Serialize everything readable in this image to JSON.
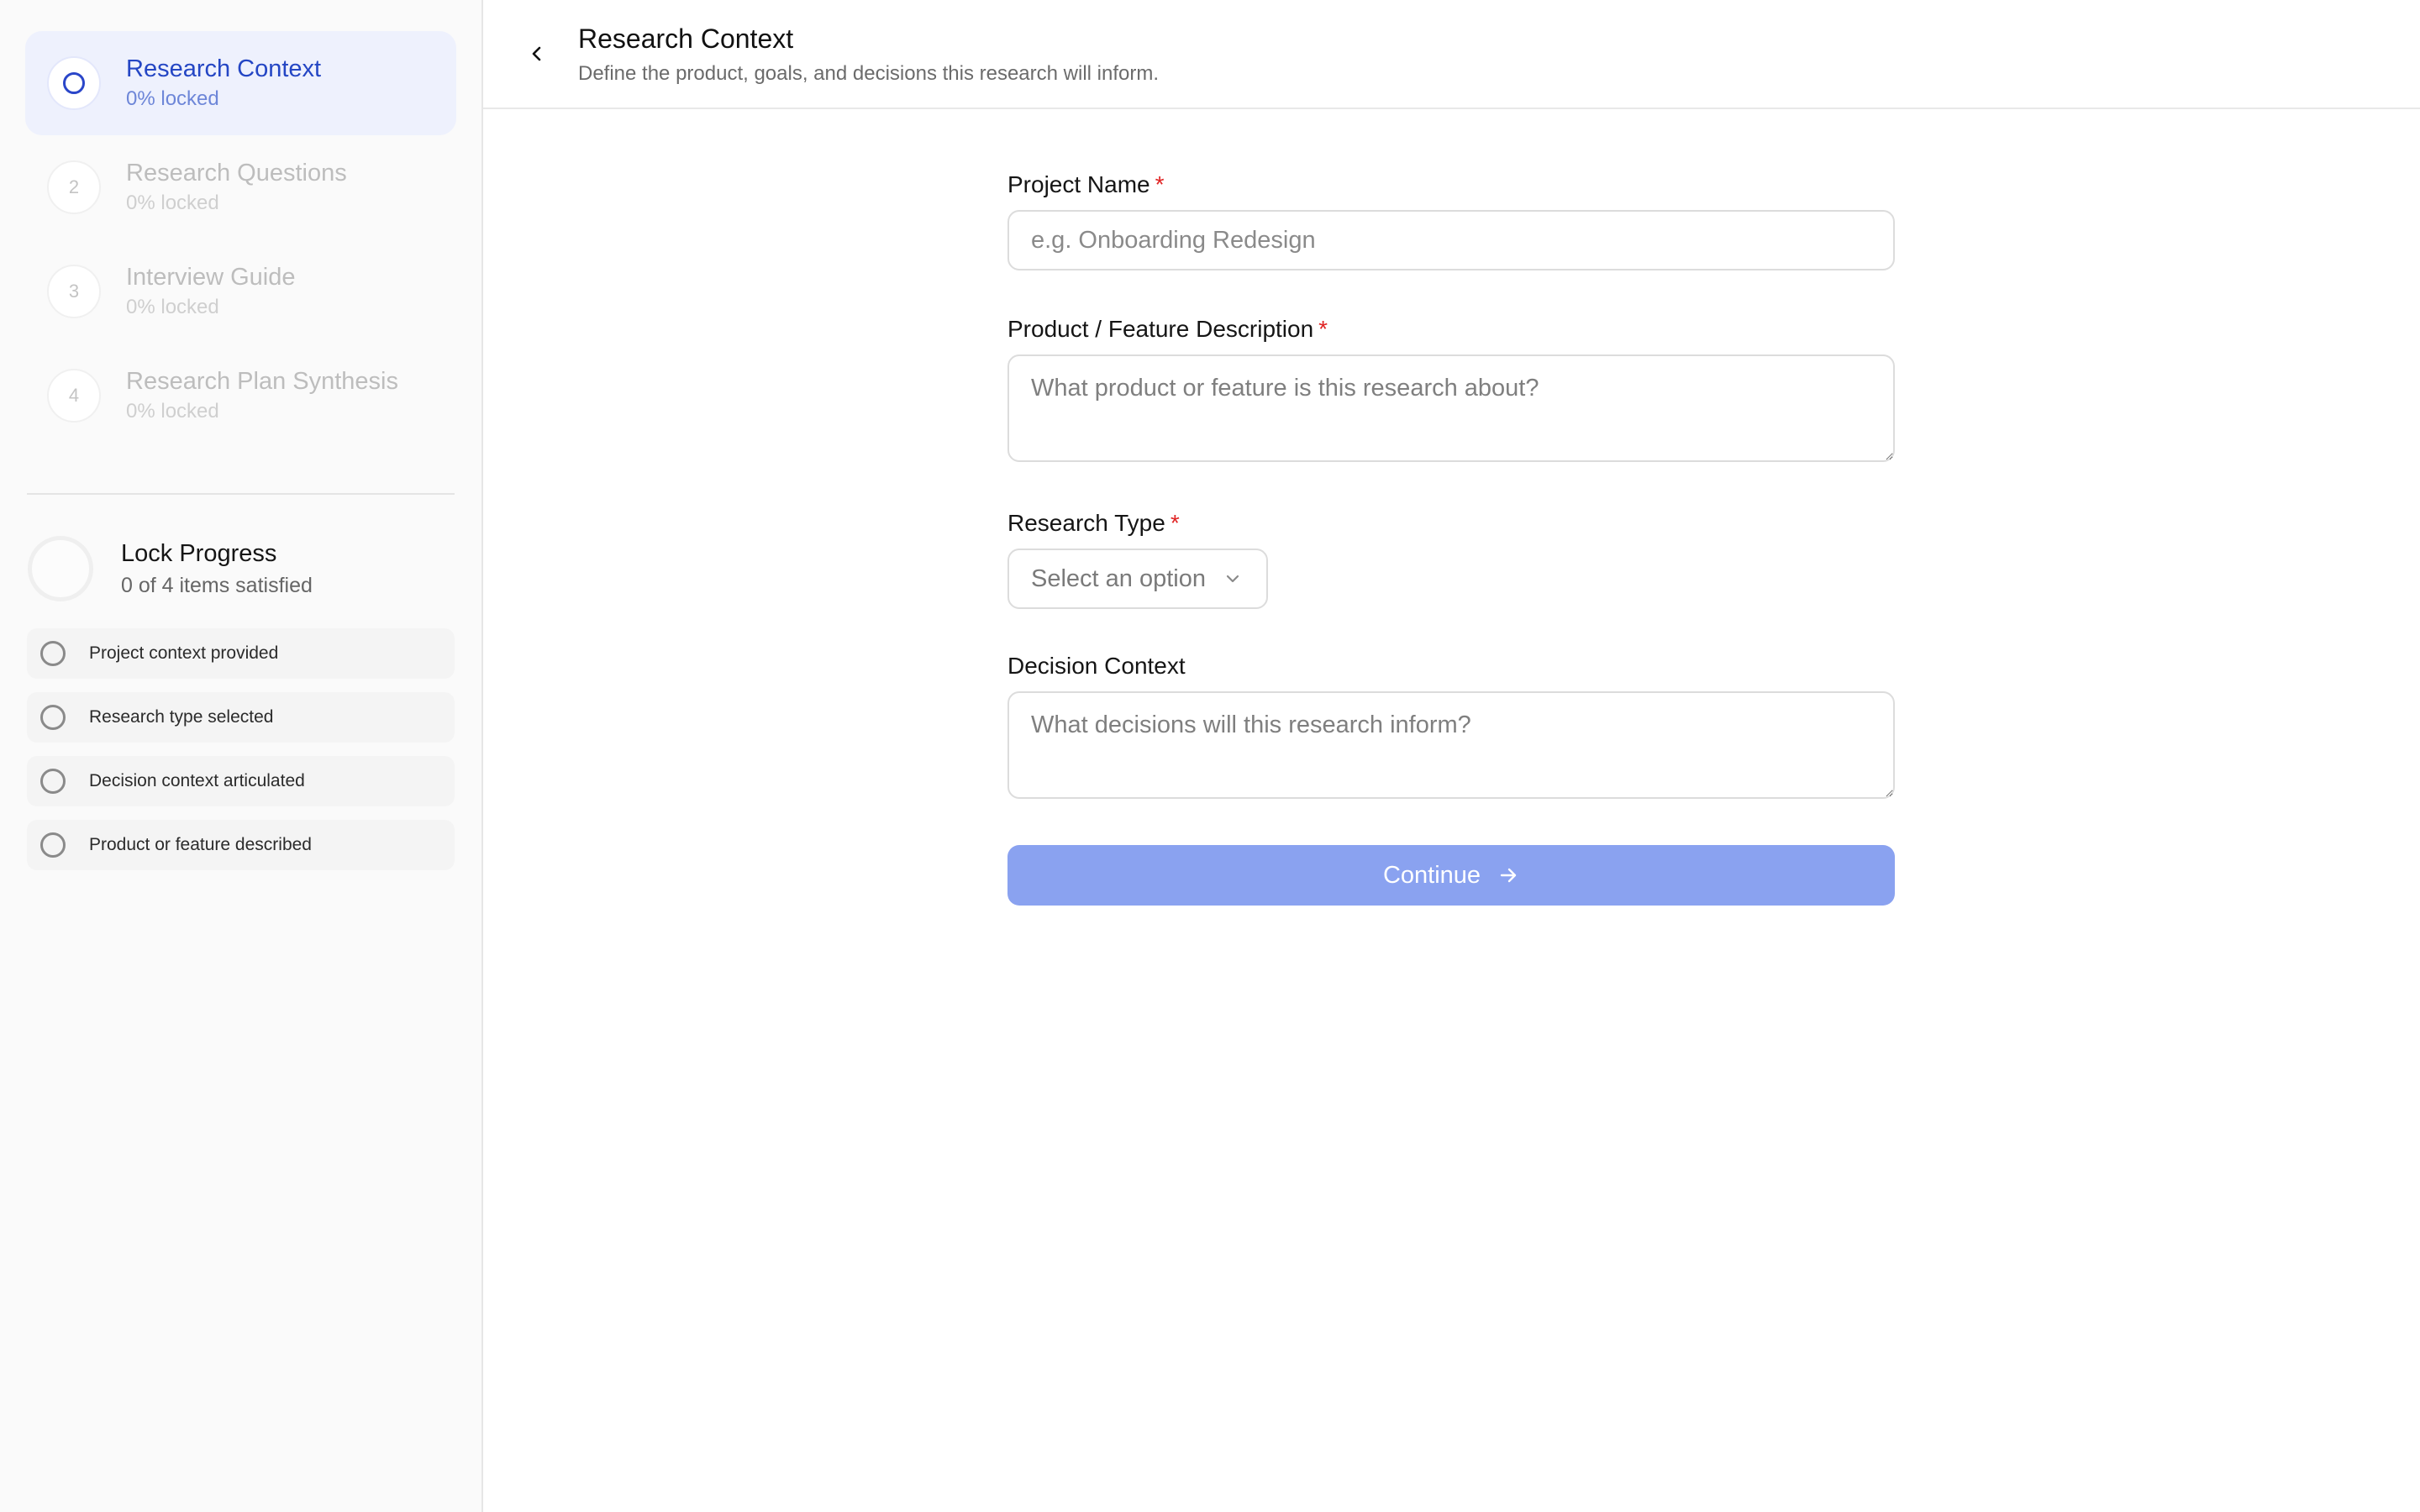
{
  "sidebar": {
    "steps": [
      {
        "number": "",
        "title": "Research Context",
        "sub": "0% locked",
        "active": true
      },
      {
        "number": "2",
        "title": "Research Questions",
        "sub": "0% locked",
        "active": false
      },
      {
        "number": "3",
        "title": "Interview Guide",
        "sub": "0% locked",
        "active": false
      },
      {
        "number": "4",
        "title": "Research Plan Synthesis",
        "sub": "0% locked",
        "active": false
      }
    ],
    "lock": {
      "title": "Lock Progress",
      "sub": "0 of 4 items satisfied",
      "progress": 0
    },
    "checklist": [
      {
        "label": "Project context provided"
      },
      {
        "label": "Research type selected"
      },
      {
        "label": "Decision context articulated"
      },
      {
        "label": "Product or feature described"
      }
    ]
  },
  "header": {
    "title": "Research Context",
    "subtitle": "Define the product, goals, and decisions this research will inform."
  },
  "form": {
    "project_name": {
      "label": "Project Name",
      "required": "*",
      "placeholder": "e.g. Onboarding Redesign",
      "value": ""
    },
    "description": {
      "label": "Product / Feature Description",
      "required": "*",
      "placeholder": "What product or feature is this research about?",
      "value": ""
    },
    "research_type": {
      "label": "Research Type",
      "required": "*",
      "selected": "Select an option"
    },
    "decision_context": {
      "label": "Decision Context",
      "placeholder": "What decisions will this research inform?",
      "value": ""
    },
    "continue_label": "Continue"
  },
  "colors": {
    "accent": "#2446c4",
    "active_bg": "#eef1fd",
    "button_disabled": "#8aa2f0",
    "required": "#e02424"
  },
  "icons": {
    "back": "chevron-left-icon",
    "select": "chevron-down-icon",
    "continue": "arrow-right-icon",
    "check": "circle-icon"
  }
}
